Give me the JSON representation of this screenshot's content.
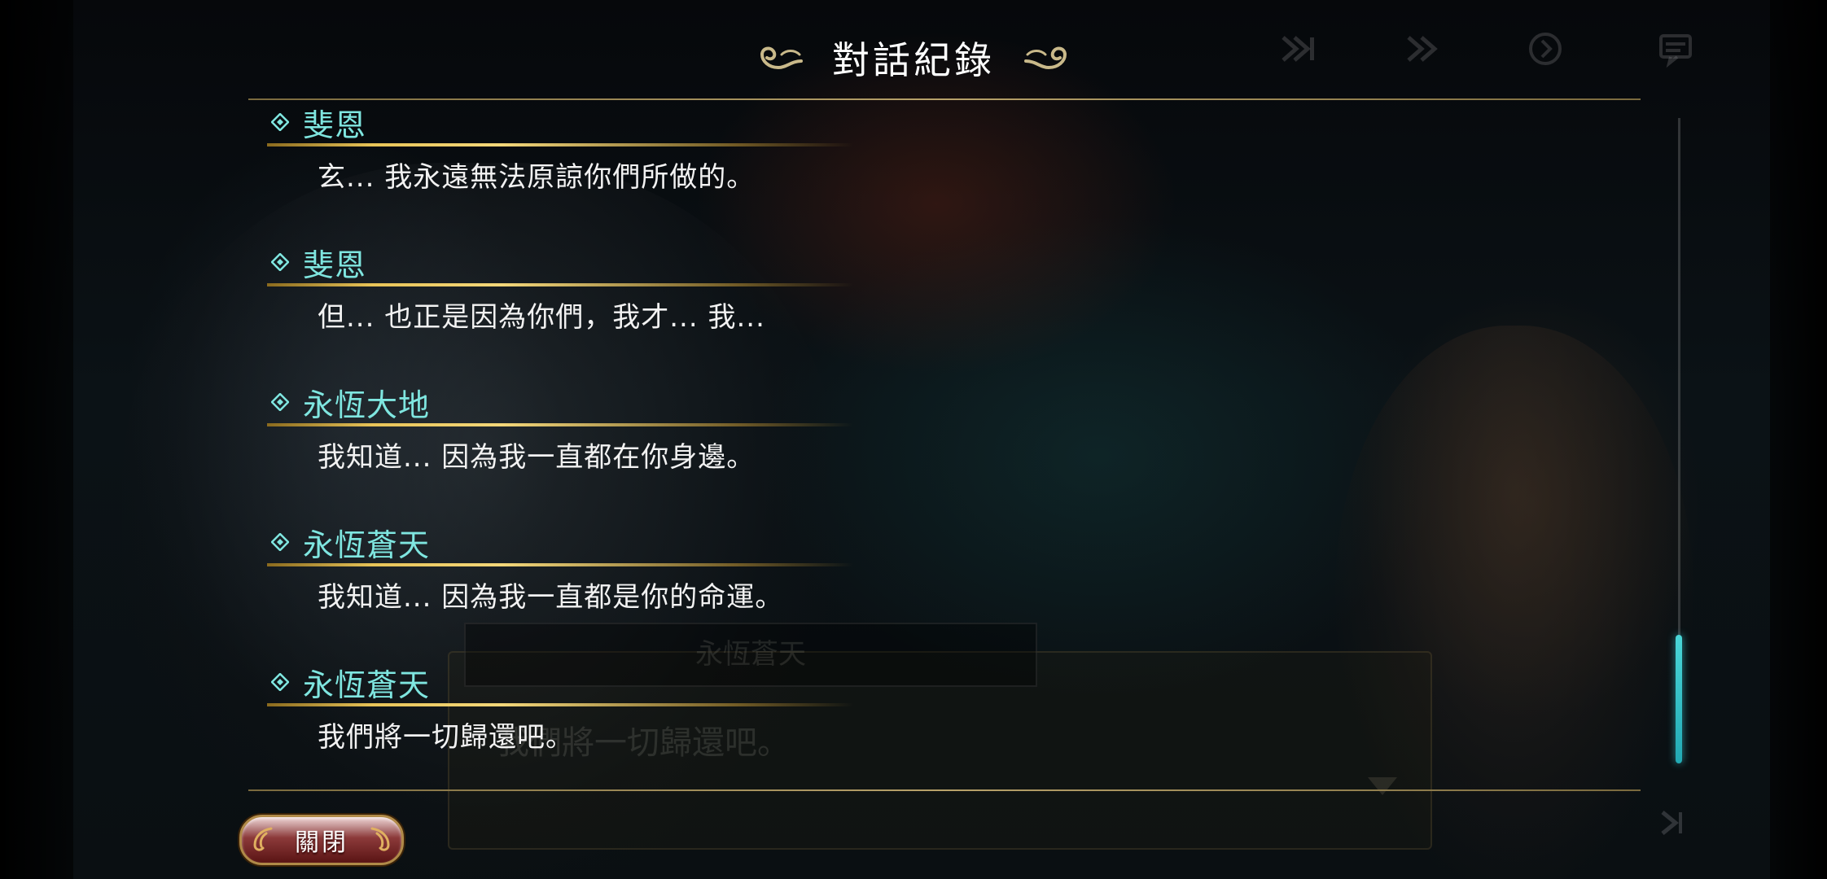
{
  "header": {
    "title": "對話紀錄",
    "controls": [
      "skip-icon",
      "fast-forward-icon",
      "auto-play-icon",
      "log-icon"
    ]
  },
  "log": {
    "entries": [
      {
        "speaker": "斐恩",
        "text": "玄... 我永遠無法原諒你們所做的。"
      },
      {
        "speaker": "斐恩",
        "text": "但... 也正是因為你們，我才... 我..."
      },
      {
        "speaker": "永恆大地",
        "text": "我知道... 因為我一直都在你身邊。"
      },
      {
        "speaker": "永恆蒼天",
        "text": "我知道... 因為我一直都是你的命運。"
      },
      {
        "speaker": "永恆蒼天",
        "text": "我們將一切歸還吧。"
      }
    ]
  },
  "background_dialog": {
    "speaker": "永恆蒼天",
    "text": "我們將一切歸還吧。"
  },
  "footer": {
    "close_label": "關閉"
  },
  "colors": {
    "speaker": "#7fe6e0",
    "underline": "#e8c458",
    "scroll_thumb": "#4ad6d8",
    "close_button": "#8c3a3a"
  }
}
